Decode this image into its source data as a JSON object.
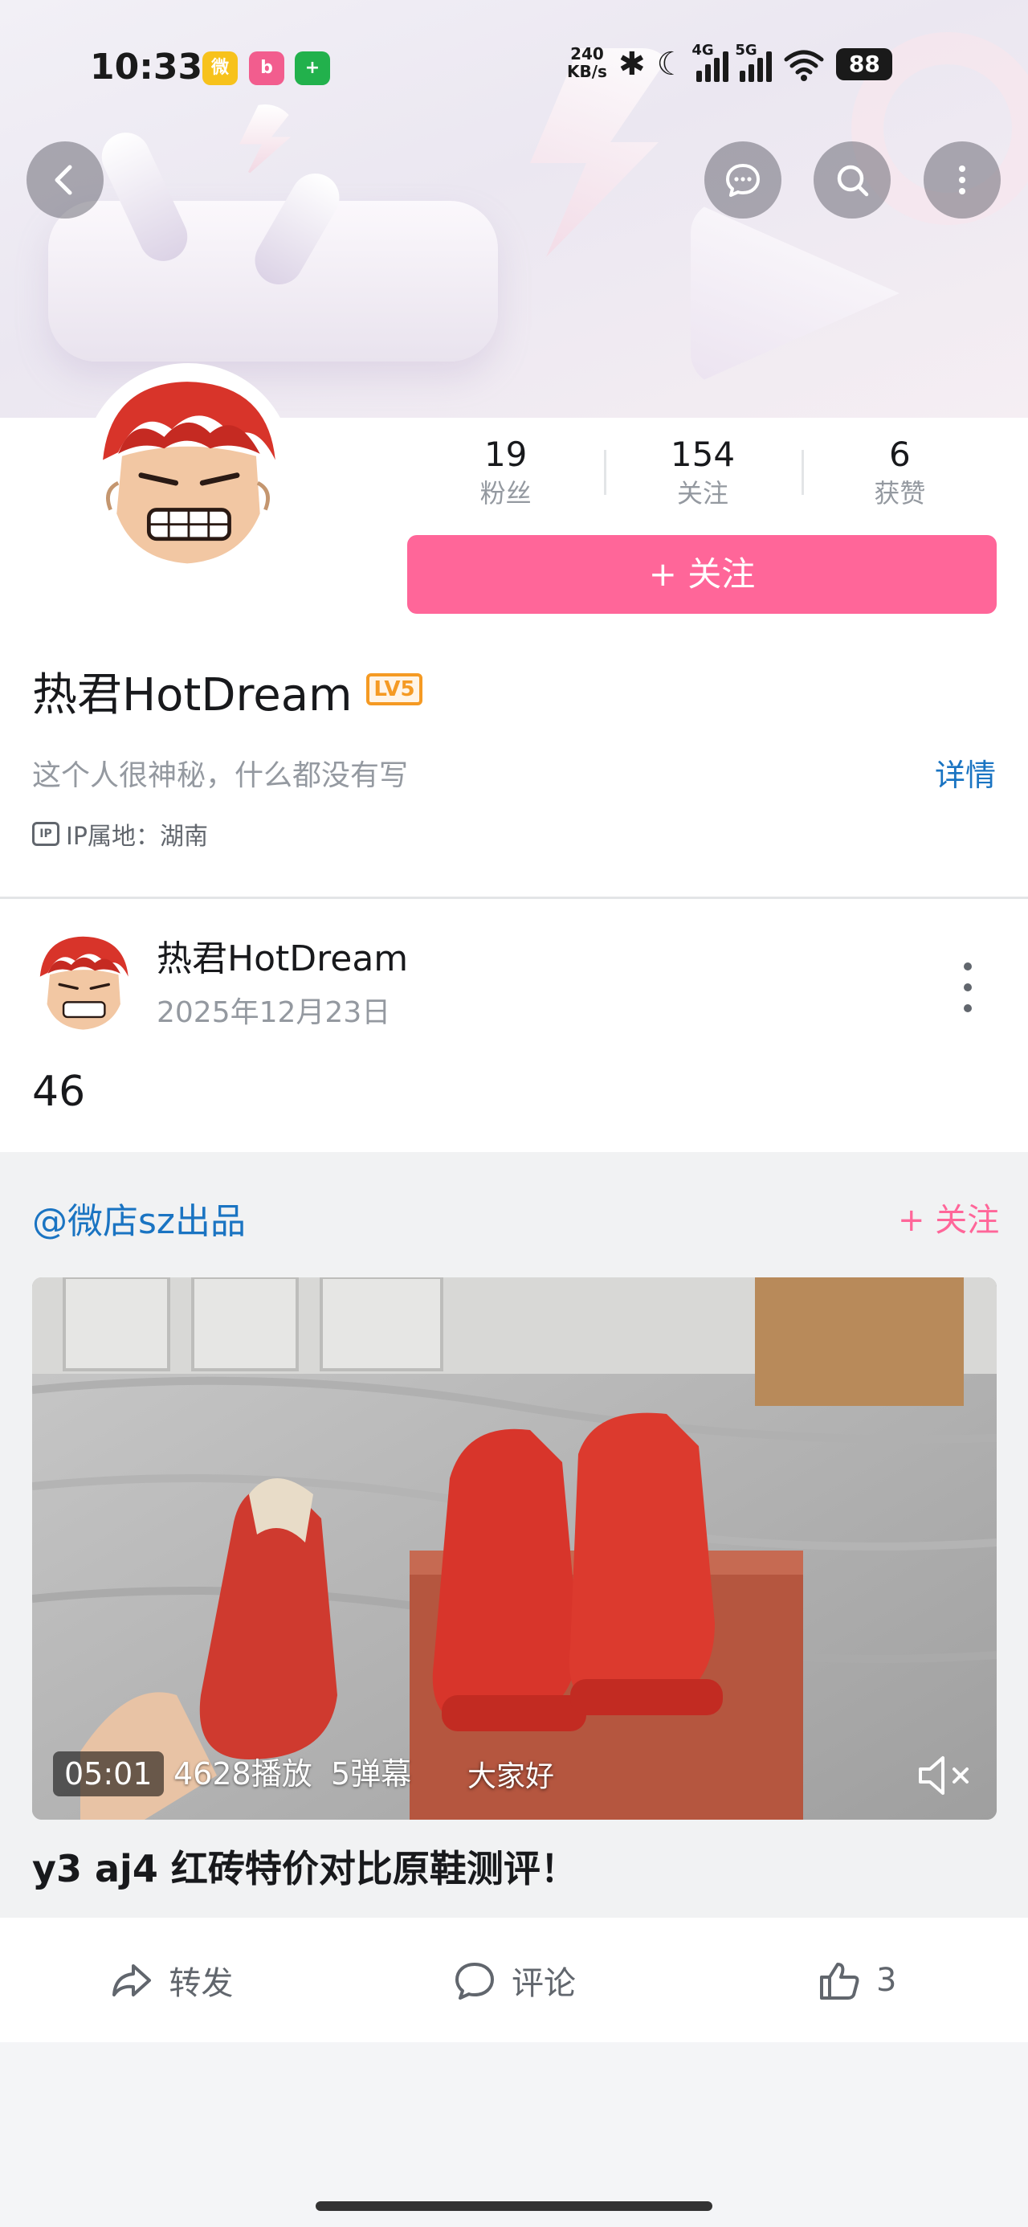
{
  "status_bar": {
    "time": "10:33",
    "net_speed_value": "240",
    "net_speed_unit": "KB/s",
    "signal_1_tag": "4G",
    "signal_2_tag": "5G",
    "battery": "88"
  },
  "profile": {
    "stats": [
      {
        "value": "19",
        "label": "粉丝"
      },
      {
        "value": "154",
        "label": "关注"
      },
      {
        "value": "6",
        "label": "获赞"
      }
    ],
    "follow_button": "+ 关注",
    "username": "热君HotDream",
    "level_badge": "LV5",
    "bio": "这个人很神秘，什么都没有写",
    "detail_link": "详情",
    "ip_icon": "IP",
    "ip_location": "IP属地：湖南"
  },
  "post": {
    "author": "热君HotDream",
    "date": "2025年12月23日",
    "text": "46"
  },
  "shared": {
    "author": "@微店sz出品",
    "follow": "+ 关注",
    "video": {
      "duration": "05:01",
      "plays": "4628播放",
      "danmaku": "5弹幕",
      "subtitle": "大家好"
    },
    "title": "y3 aj4 红砖特价对比原鞋测评！"
  },
  "actions": {
    "share": "转发",
    "comment": "评论",
    "like_count": "3"
  },
  "colors": {
    "accent_pink": "#ff6699",
    "link_blue": "#1a74c2",
    "level_orange": "#f59a23"
  }
}
